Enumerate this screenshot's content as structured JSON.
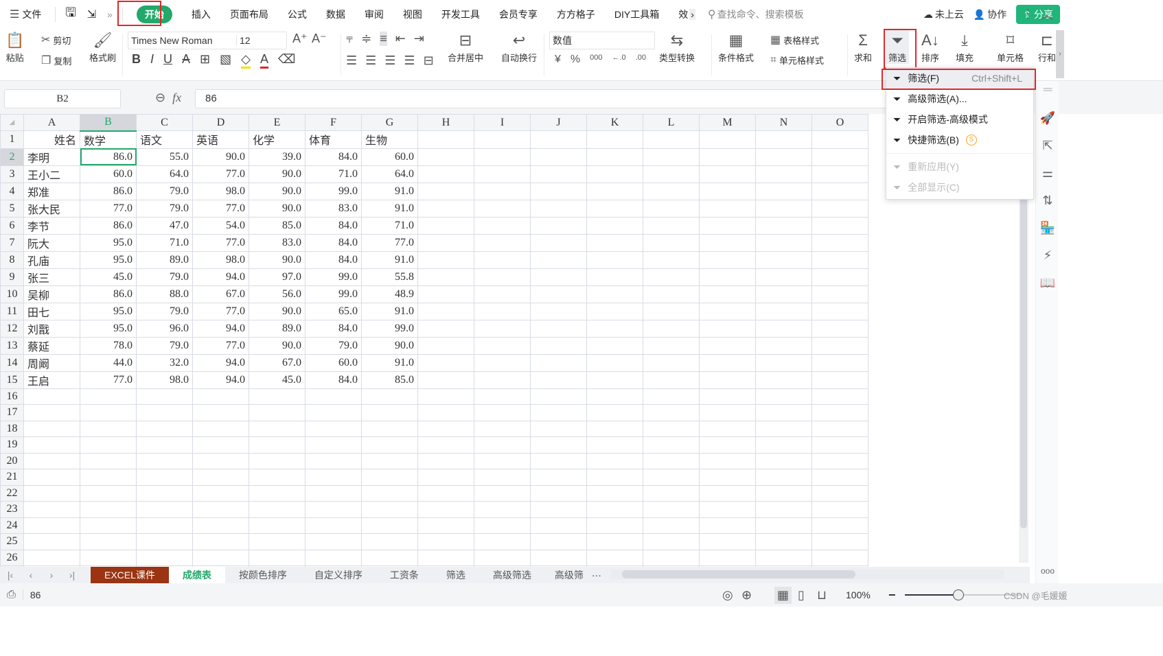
{
  "menubar": {
    "file_label": "文件",
    "tabs": [
      "开始",
      "插入",
      "页面布局",
      "公式",
      "数据",
      "审阅",
      "视图",
      "开发工具",
      "会员专享",
      "方方格子",
      "DIY工具箱",
      "效"
    ],
    "active_tab": "开始",
    "search_placeholder": "查找命令、搜索模板",
    "cloud_label": "未上云",
    "collab_label": "协作",
    "share_label": "分享"
  },
  "ribbon": {
    "paste": "粘贴",
    "cut": "剪切",
    "copy": "复制",
    "format_painter": "格式刷",
    "font_name": "Times New Roman",
    "font_size": "12",
    "merge_center": "合并居中",
    "wrap_text": "自动换行",
    "number_format": "数值",
    "type_convert": "类型转换",
    "conditional_format": "条件格式",
    "table_style": "表格样式",
    "cell_style": "单元格样式",
    "sum": "求和",
    "filter": "筛选",
    "sort": "排序",
    "fill": "填充",
    "cell": "单元格",
    "row_col": "行和"
  },
  "formula_bar": {
    "name_box": "B2",
    "fx": "fx",
    "value": "86"
  },
  "grid": {
    "columns": [
      "A",
      "B",
      "C",
      "D",
      "E",
      "F",
      "G",
      "H",
      "I",
      "J",
      "K",
      "L",
      "M",
      "N",
      "O"
    ],
    "selected_column": "B",
    "selected_row": 2,
    "header_row": [
      "姓名",
      "数学",
      "语文",
      "英语",
      "化学",
      "体育",
      "生物"
    ],
    "rows": [
      [
        "李明",
        "86.0",
        "55.0",
        "90.0",
        "39.0",
        "84.0",
        "60.0"
      ],
      [
        "王小二",
        "60.0",
        "64.0",
        "77.0",
        "90.0",
        "71.0",
        "64.0"
      ],
      [
        "郑准",
        "86.0",
        "79.0",
        "98.0",
        "90.0",
        "99.0",
        "91.0"
      ],
      [
        "张大民",
        "77.0",
        "79.0",
        "77.0",
        "90.0",
        "83.0",
        "91.0"
      ],
      [
        "李节",
        "86.0",
        "47.0",
        "54.0",
        "85.0",
        "84.0",
        "71.0"
      ],
      [
        "阮大",
        "95.0",
        "71.0",
        "77.0",
        "83.0",
        "84.0",
        "77.0"
      ],
      [
        "孔庙",
        "95.0",
        "89.0",
        "98.0",
        "90.0",
        "84.0",
        "91.0"
      ],
      [
        "张三",
        "45.0",
        "79.0",
        "94.0",
        "97.0",
        "99.0",
        "55.8"
      ],
      [
        "吴柳",
        "86.0",
        "88.0",
        "67.0",
        "56.0",
        "99.0",
        "48.9"
      ],
      [
        "田七",
        "95.0",
        "79.0",
        "77.0",
        "90.0",
        "65.0",
        "91.0"
      ],
      [
        "刘戬",
        "95.0",
        "96.0",
        "94.0",
        "89.0",
        "84.0",
        "99.0"
      ],
      [
        "蔡延",
        "78.0",
        "79.0",
        "77.0",
        "90.0",
        "79.0",
        "90.0"
      ],
      [
        "周阚",
        "44.0",
        "32.0",
        "94.0",
        "67.0",
        "60.0",
        "91.0"
      ],
      [
        "王启",
        "77.0",
        "98.0",
        "94.0",
        "45.0",
        "84.0",
        "85.0"
      ]
    ],
    "total_visible_rows": 28
  },
  "filter_menu": {
    "items": [
      {
        "label": "筛选(F)",
        "shortcut": "Ctrl+Shift+L",
        "state": "highlighted"
      },
      {
        "label": "高级筛选(A)...",
        "state": "enabled"
      },
      {
        "label": "开启筛选-高级模式",
        "state": "enabled"
      },
      {
        "label": "快捷筛选(B)",
        "state": "enabled",
        "badge": "S"
      },
      {
        "label": "重新应用(Y)",
        "state": "disabled"
      },
      {
        "label": "全部显示(C)",
        "state": "disabled"
      }
    ]
  },
  "sheet_tabs": [
    "EXCEL课件",
    "成绩表",
    "按颜色排序",
    "自定义排序",
    "工资条",
    "筛选",
    "高级筛选",
    "高级筛"
  ],
  "active_sheet": "成绩表",
  "status": {
    "value": "86",
    "zoom": "100%"
  },
  "watermark": "CSDN @毛媛媛"
}
